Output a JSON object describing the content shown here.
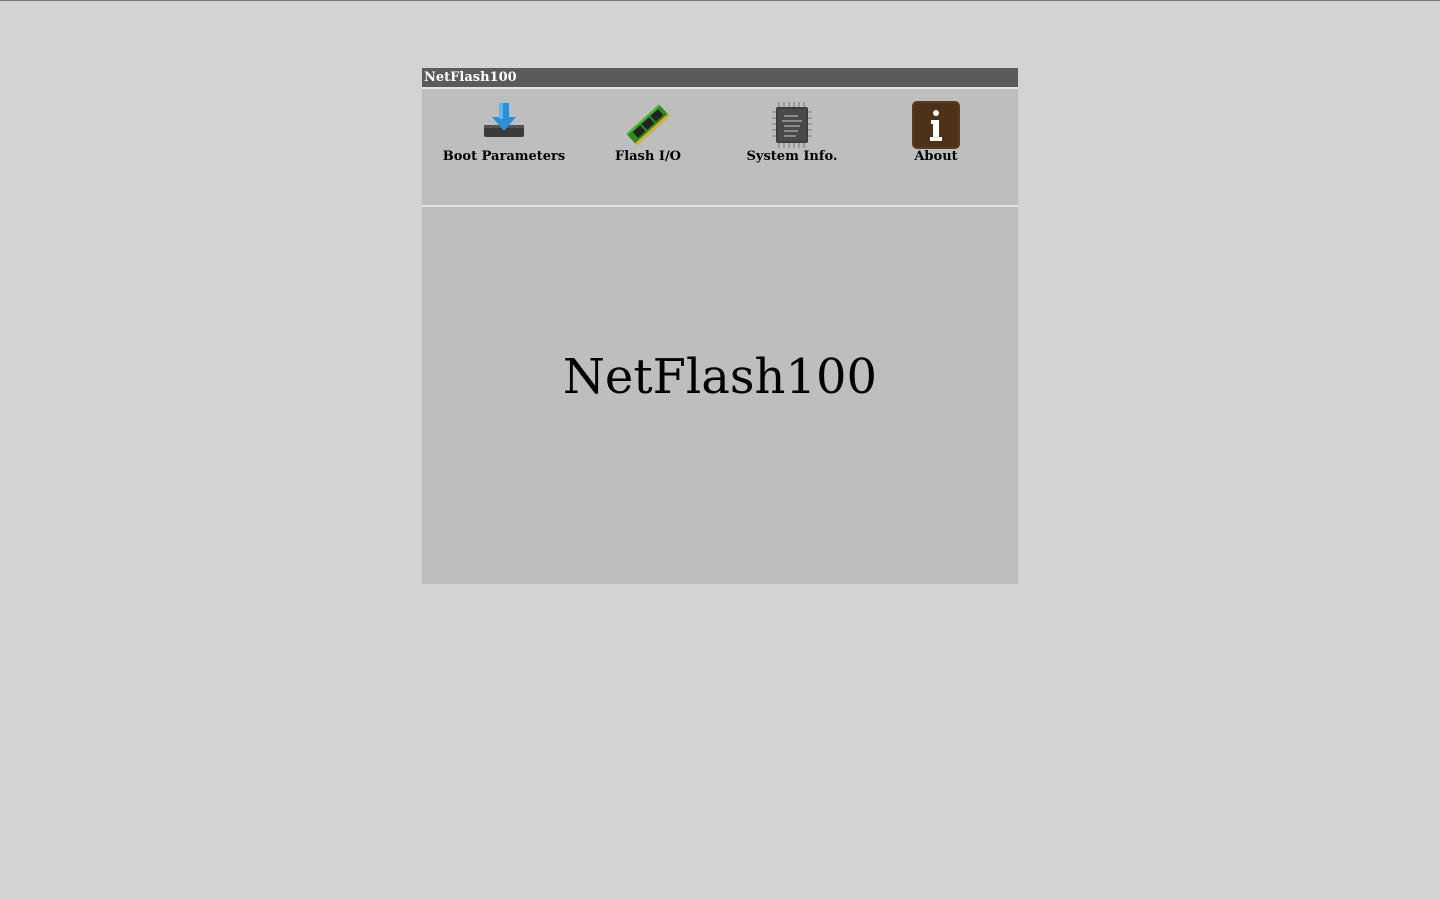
{
  "window": {
    "title": "NetFlash100"
  },
  "toolbar": {
    "items": [
      {
        "label": "Boot Parameters",
        "icon": "download-chip-icon"
      },
      {
        "label": "Flash I/O",
        "icon": "memory-module-icon"
      },
      {
        "label": "System Info.",
        "icon": "processor-chip-icon"
      },
      {
        "label": "About",
        "icon": "info-icon"
      }
    ]
  },
  "main": {
    "heading": "NetFlash100"
  },
  "colors": {
    "page_bg": "#d3d3d3",
    "panel_bg": "#bebebe",
    "titlebar_bg": "#5b5b5b",
    "about_icon_bg": "#5a3a1e",
    "download_arrow": "#2a8fd8",
    "board_green": "#2f8a1e"
  }
}
